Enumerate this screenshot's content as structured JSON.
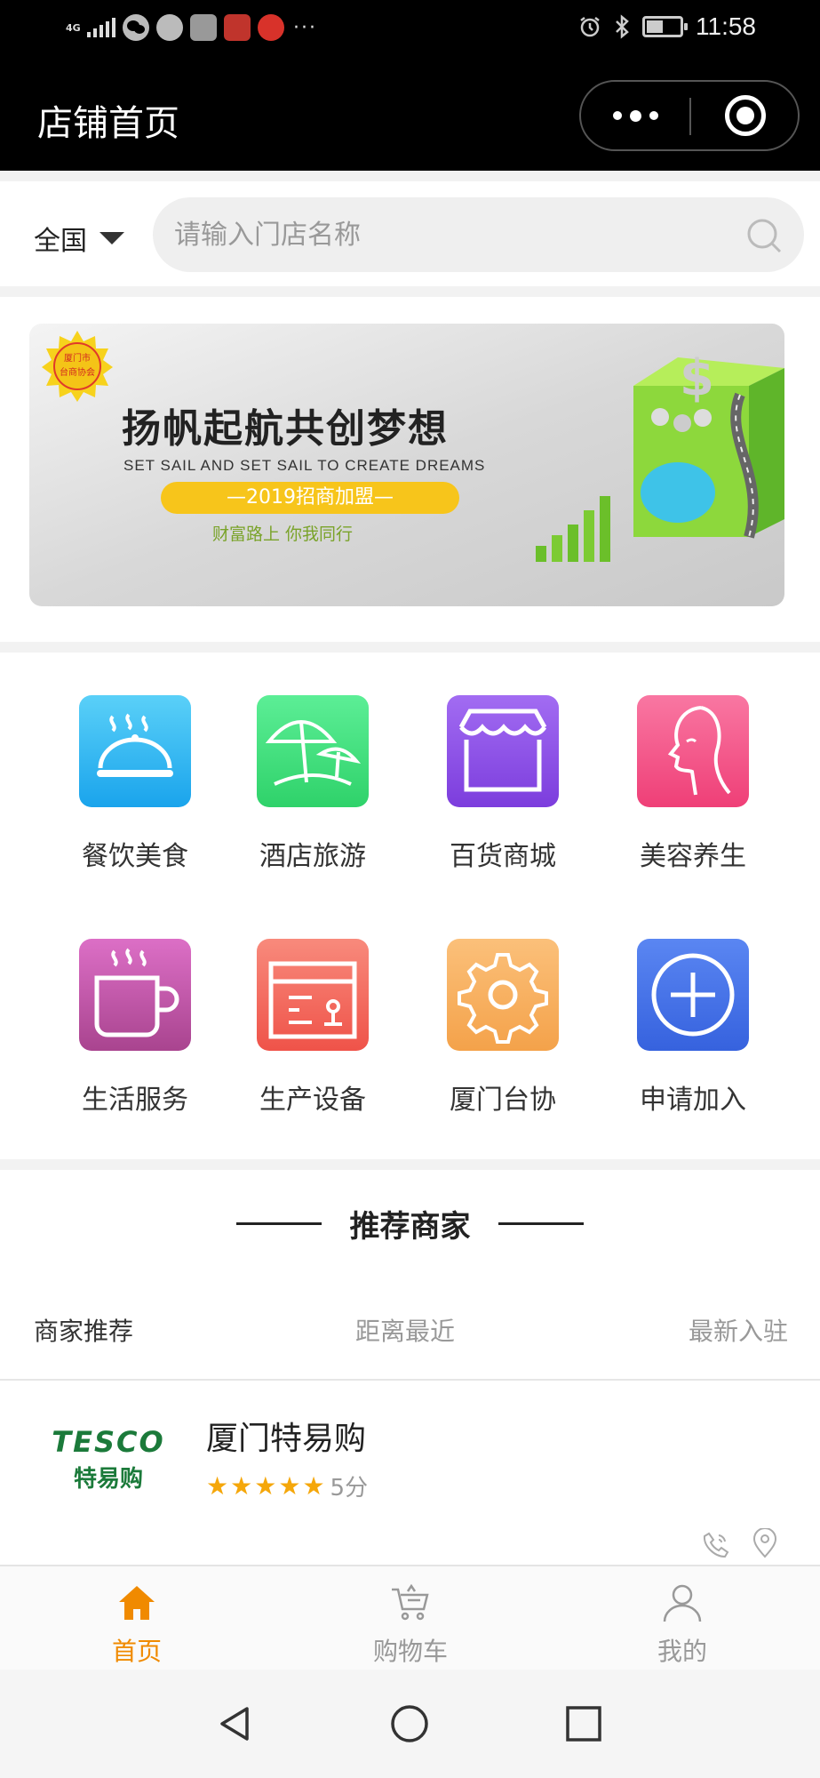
{
  "status_bar": {
    "network": "4G",
    "time": "11:58",
    "more": "···"
  },
  "nav": {
    "title": "店铺首页"
  },
  "search": {
    "region": "全国",
    "placeholder": "请输入门店名称"
  },
  "banner": {
    "title_cn": "扬帆起航共创梦想",
    "title_en": "SET SAIL AND SET SAIL TO CREATE DREAMS",
    "pill": "—2019招商加盟—",
    "subtitle": "财富路上 你我同行",
    "badge_top": "厦门市",
    "badge_bottom": "台商协会"
  },
  "categories": [
    {
      "label": "餐饮美食",
      "icon": "cloche-icon",
      "color": "#29b8f0"
    },
    {
      "label": "酒店旅游",
      "icon": "beach-umbrella-icon",
      "color": "#3fe07f"
    },
    {
      "label": "百货商城",
      "icon": "store-icon",
      "color": "#8d4fe8"
    },
    {
      "label": "美容养生",
      "icon": "face-icon",
      "color": "#f3568c"
    },
    {
      "label": "生活服务",
      "icon": "coffee-cup-icon",
      "color": "#c053a6"
    },
    {
      "label": "生产设备",
      "icon": "box-icon",
      "color": "#f2645a"
    },
    {
      "label": "厦门台协",
      "icon": "gear-icon",
      "color": "#f7b45c"
    },
    {
      "label": "申请加入",
      "icon": "plus-circle-icon",
      "color": "#3f6ee8"
    }
  ],
  "recommend": {
    "title": "推荐商家",
    "tabs": [
      "商家推荐",
      "距离最近",
      "最新入驻"
    ],
    "stores": [
      {
        "name": "厦门特易购",
        "logo_en": "TESCO",
        "logo_cn": "特易购",
        "rating": 5,
        "score": "5分"
      }
    ]
  },
  "tabbar": {
    "items": [
      {
        "label": "首页",
        "icon": "home-icon",
        "active": true
      },
      {
        "label": "购物车",
        "icon": "cart-icon",
        "active": false
      },
      {
        "label": "我的",
        "icon": "user-icon",
        "active": false
      }
    ]
  },
  "colors": {
    "accent": "#f08a00",
    "inactive": "#999999",
    "star": "#f5a70a",
    "brand_green": "#1b7a3a"
  }
}
